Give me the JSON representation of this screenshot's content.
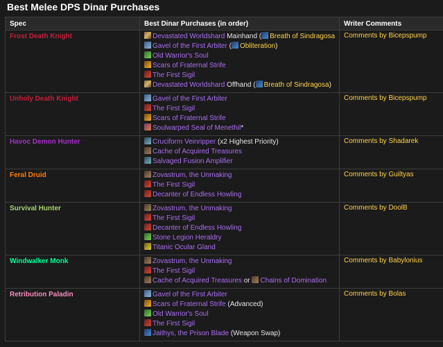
{
  "title": "Best Melee DPS Dinar Purchases",
  "headers": [
    "Spec",
    "Best Dinar Purchases (in order)",
    "Writer Comments"
  ],
  "rows": [
    {
      "spec": "Frost Death Knight",
      "spec_color": "#c41e3a",
      "comment": "Comments by Bicepspump",
      "items": [
        [
          "Devastated Worldshard",
          " Mainhand (",
          "Breath of Sindragosa",
          ")"
        ],
        [
          "Gavel of the First Arbiter",
          " (",
          "Obliteration",
          ")"
        ],
        [
          "Old Warrior's Soul",
          "",
          "",
          ""
        ],
        [
          "Scars of Fraternal Strife",
          "",
          "",
          ""
        ],
        [
          "The First Sigil",
          "",
          "",
          ""
        ],
        [
          "Devastated Worldshard",
          " Offhand (",
          "Breath of Sindragosa",
          ")"
        ]
      ]
    },
    {
      "spec": "Unholy Death Knight",
      "spec_color": "#c41e3a",
      "comment": "Comments by Bicepspump",
      "items": [
        [
          "Gavel of the First Arbiter",
          "",
          "",
          ""
        ],
        [
          "The First Sigil",
          "",
          "",
          ""
        ],
        [
          "Scars of Fraternal Strife",
          "",
          "",
          ""
        ],
        [
          "Soulwarped Seal of Menethil",
          "*",
          "",
          ""
        ]
      ]
    },
    {
      "spec": "Havoc Demon Hunter",
      "spec_color": "#a330c9",
      "comment": "Comments by Shadarek",
      "items": [
        [
          "Cruciform Veinripper",
          " (x2 Highest Priority)",
          "",
          ""
        ],
        [
          "Cache of Acquired Treasures",
          "",
          "",
          ""
        ],
        [
          "Salvaged Fusion Amplifier",
          "",
          "",
          ""
        ]
      ]
    },
    {
      "spec": "Feral Druid",
      "spec_color": "#ff7c0a",
      "comment": "Comments by Guiltyas",
      "items": [
        [
          "Zovastrum, the Unmaking",
          "",
          "",
          ""
        ],
        [
          "The First Sigil",
          "",
          "",
          ""
        ],
        [
          "Decanter of Endless Howling",
          "",
          "",
          ""
        ]
      ]
    },
    {
      "spec": "Survival Hunter",
      "spec_color": "#aad372",
      "comment": "Comments by DoolB",
      "items": [
        [
          "Zovastrum, the Unmaking",
          "",
          "",
          ""
        ],
        [
          "The First Sigil",
          "",
          "",
          ""
        ],
        [
          "Decanter of Endless Howling",
          "",
          "",
          ""
        ],
        [
          "Stone Legion Heraldry",
          "",
          "",
          ""
        ],
        [
          "Titanic Ocular Gland",
          "",
          "",
          ""
        ]
      ]
    },
    {
      "spec": "Windwalker Monk",
      "spec_color": "#00ff98",
      "comment": "Comments by Babylonius",
      "items": [
        [
          "Zovastrum, the Unmaking",
          "",
          "",
          ""
        ],
        [
          "The First Sigil",
          "",
          "",
          ""
        ],
        [
          "Cache of Acquired Treasures",
          " or ",
          "Chains of Domination",
          ""
        ]
      ]
    },
    {
      "spec": "Retribution Paladin",
      "spec_color": "#f48cba",
      "comment": "Comments by Bolas",
      "items": [
        [
          "Gavel of the First Arbiter",
          "",
          "",
          ""
        ],
        [
          "Scars of Fraternal Strife",
          " (Advanced)",
          "",
          ""
        ],
        [
          "Old Warrior's Soul",
          "",
          "",
          ""
        ],
        [
          "The First Sigil",
          "",
          "",
          ""
        ],
        [
          "Jaithys, the Prison Blade",
          " (Weapon Swap)",
          "",
          ""
        ]
      ]
    }
  ]
}
